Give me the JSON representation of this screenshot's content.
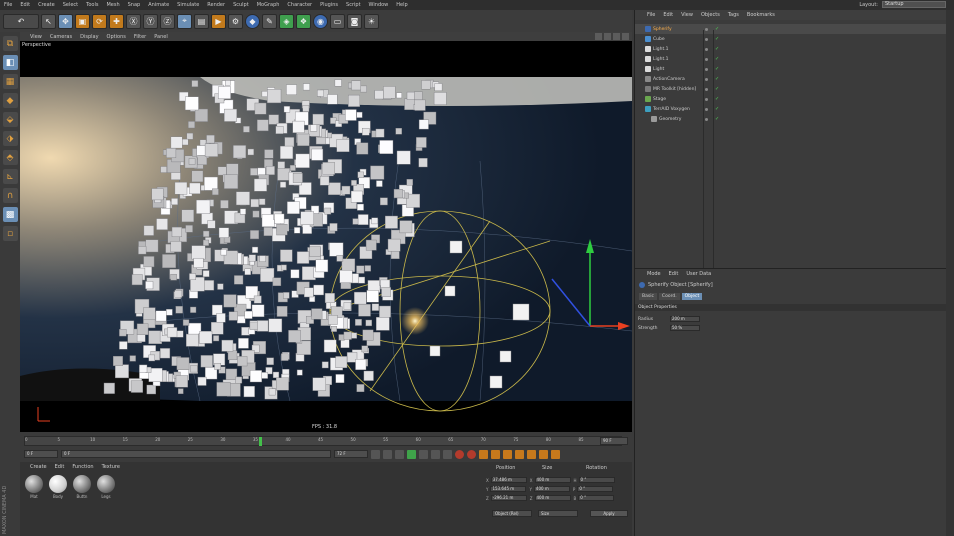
{
  "menu": [
    "File",
    "Edit",
    "Create",
    "Select",
    "Tools",
    "Mesh",
    "Snap",
    "Animate",
    "Simulate",
    "Render",
    "Sculpt",
    "MoGraph",
    "Character",
    "Plugins",
    "Script",
    "Window",
    "Help"
  ],
  "layout": {
    "label": "Layout:",
    "value": "Startup"
  },
  "viewport": {
    "menu": [
      "View",
      "Cameras",
      "Display",
      "Options",
      "Filter",
      "Panel"
    ],
    "label": "Perspective",
    "fps": "FPS : 31.8"
  },
  "timeline": {
    "ticks": [
      "0",
      "5",
      "10",
      "15",
      "20",
      "25",
      "30",
      "35",
      "40",
      "45",
      "50",
      "55",
      "60",
      "65",
      "70",
      "75",
      "80",
      "85",
      "90"
    ],
    "current_frame": 36,
    "end_frame_field": "90 F",
    "start_field": "0 F",
    "min_field": "0 F",
    "max_field": "90 F",
    "max2_field": "72 F"
  },
  "material_manager": {
    "menu": [
      "Create",
      "Edit",
      "Function",
      "Texture"
    ],
    "materials": [
      "Mat",
      "Body",
      "Buttn",
      "Legs"
    ],
    "brand": "MAXON CINEMA 4D"
  },
  "coordinates": {
    "headers": [
      "Position",
      "Size",
      "Rotation"
    ],
    "rows": [
      {
        "axis_p": "X",
        "pos": "37.486 m",
        "axis_s": "X",
        "size": "400 m",
        "axis_r": "H",
        "rot": "0 °"
      },
      {
        "axis_p": "Y",
        "pos": "153.645 m",
        "axis_s": "Y",
        "size": "400 m",
        "axis_r": "P",
        "rot": "0 °"
      },
      {
        "axis_p": "Z",
        "pos": "-296.21 m",
        "axis_s": "Z",
        "size": "400 m",
        "axis_r": "B",
        "rot": "0 °"
      }
    ],
    "mode_select": "Object (Rel)",
    "size_select": "Size",
    "apply": "Apply"
  },
  "object_manager": {
    "menu": [
      "File",
      "Edit",
      "View",
      "Objects",
      "Tags",
      "Bookmarks"
    ],
    "objects": [
      {
        "name": "Spherify",
        "indent": 0,
        "color": "#3d6ab0",
        "selected": true
      },
      {
        "name": "Cube",
        "indent": 0,
        "color": "#4b8fd0",
        "selected": false
      },
      {
        "name": "Light.1",
        "indent": 0,
        "color": "#dddddd",
        "selected": false
      },
      {
        "name": "Light.1",
        "indent": 0,
        "color": "#dddddd",
        "selected": false
      },
      {
        "name": "Light",
        "indent": 0,
        "color": "#dddddd",
        "selected": false
      },
      {
        "name": "ActionCamera",
        "indent": 0,
        "color": "#8a8a8a",
        "selected": false
      },
      {
        "name": "MR Toolkit [hidden]",
        "indent": 0,
        "color": "#7a7a7a",
        "selected": false
      },
      {
        "name": "Stage",
        "indent": 0,
        "color": "#6aa84f",
        "selected": false
      },
      {
        "name": "TerrAID Voxygen",
        "indent": 0,
        "color": "#3d9fbf",
        "selected": false
      },
      {
        "name": "Geometry",
        "indent": 1,
        "color": "#9a9a9a",
        "selected": false
      }
    ]
  },
  "attribute_manager": {
    "menu": [
      "Mode",
      "Edit",
      "User Data"
    ],
    "title": "Spherify Object [Spherify]",
    "tabs": [
      "Basic",
      "Coord.",
      "Object"
    ],
    "active_tab": "Object",
    "section": "Object Properties",
    "props": [
      {
        "label": "Radius",
        "value": "200 m"
      },
      {
        "label": "Strength",
        "value": "50 %"
      }
    ]
  }
}
